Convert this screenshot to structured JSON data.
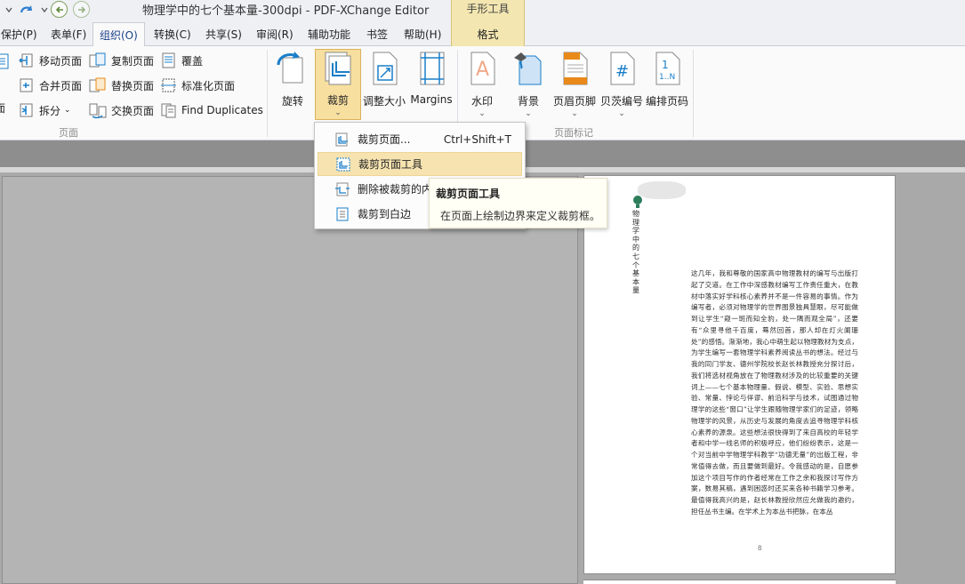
{
  "window": {
    "title": "物理学中的七个基本量-300dpi - PDF-XChange Editor"
  },
  "context_tab_group": {
    "title": "手形工具",
    "tab": "格式"
  },
  "tabs": [
    {
      "label": "保护(P)"
    },
    {
      "label": "表单(F)"
    },
    {
      "label": "组织(O)",
      "active": true
    },
    {
      "label": "转换(C)"
    },
    {
      "label": "共享(S)"
    },
    {
      "label": "审阅(R)"
    },
    {
      "label": "辅助功能"
    },
    {
      "label": "书签"
    },
    {
      "label": "帮助(H)"
    }
  ],
  "ribbon": {
    "pages_group": {
      "label": "页面",
      "partial_labels": [
        "面",
        "拆分"
      ],
      "items": [
        {
          "label": "移动页面",
          "icon": "move-pages-icon"
        },
        {
          "label": "合并页面",
          "icon": "merge-pages-icon"
        },
        {
          "label": "复制页面",
          "icon": "copy-pages-icon"
        },
        {
          "label": "替换页面",
          "icon": "replace-pages-icon"
        },
        {
          "label": "交换页面",
          "icon": "swap-pages-icon"
        },
        {
          "label": "覆盖",
          "icon": "overlay-icon"
        },
        {
          "label": "标准化页面",
          "icon": "normalize-pages-icon"
        },
        {
          "label": "Find Duplicates",
          "icon": "find-duplicates-icon"
        }
      ]
    },
    "geometry_group": {
      "rotate": "旋转",
      "crop": "裁剪",
      "resize": "调整大小",
      "margins": "Margins"
    },
    "page_marks_group": {
      "label": "页面标记",
      "watermark": "水印",
      "background": "背景",
      "header_footer": "页眉页脚",
      "bates": "贝茨编号",
      "page_numbers": "编排页码"
    }
  },
  "crop_menu": {
    "items": [
      {
        "label": "裁剪页面...",
        "shortcut": "Ctrl+Shift+T"
      },
      {
        "label": "裁剪页面工具",
        "shortcut": "",
        "highlighted": true
      },
      {
        "label": "删除被裁剪的内",
        "shortcut": ""
      },
      {
        "label": "裁剪到白边",
        "shortcut": ""
      }
    ]
  },
  "tooltip": {
    "title": "裁剪页面工具",
    "description": "在页面上绘制边界来定义裁剪框。"
  },
  "document": {
    "vertical_title": "物理学中的七个基本量",
    "body": "这几年，我和尊敬的国家高中物理教材的编写与出版打起了交道。在工作中深感教材编写工作责任重大，在教材中落实好学科核心素养并不是一件容易的事情。作为编写者，必须对物理学的世界图景独具慧眼，尽可能做到让学生“窥一斑而知全豹，处一隅而观全局”，还要有“众里寻他千百度，蓦然回首，那人却在灯火阑珊处”的感悟。渐渐地，我心中萌生起以物理教材为支点，为学生编写一套物理学科素养阅读丛书的想法。经过与我的同门学友、德州学院校长赵长林教授充分探讨后，我们将选材视角放在了物理教材涉及的比较重要的关键词上——七个基本物理量、假说、模型、实验、思想实验、常量、悖论与佯谬、前沿科学与技术，试图通过物理学的这些“窗口”让学生跟随物理学家们的足迹，领略物理学的风景，从历史与发展的角度去追寻物理学科核心素养的源泉。这些想法很快得到了来自高校的年轻学者和中学一线名师的积极呼应，他们纷纷表示，这是一个对当前中学物理学科教学“功德无量”的出版工程，非常值得去做，而且要做到最好。令我感动的是，自愿参加这个项目写作的作者经常在工作之余和我探讨写作方案，数易其稿，遇到困惑时还买来各种书籍学习参考。最值得我高兴的是，赵长林教授欣然应允做我的邀约，担任丛书主编。在学术上为本丛书把脉，在本丛",
    "page_number": "8"
  },
  "colors": {
    "ribbon_bg": "#fafafa",
    "tab_bar_bg": "#eef0f4",
    "context_group_bg": "#f3e6b0",
    "pressed_button": "#f7dfa0",
    "menu_highlight": "#f6e3b0",
    "doc_area_bg": "#a9a9a9",
    "accent_blue": "#1a7ec8",
    "accent_orange": "#e8891a"
  }
}
